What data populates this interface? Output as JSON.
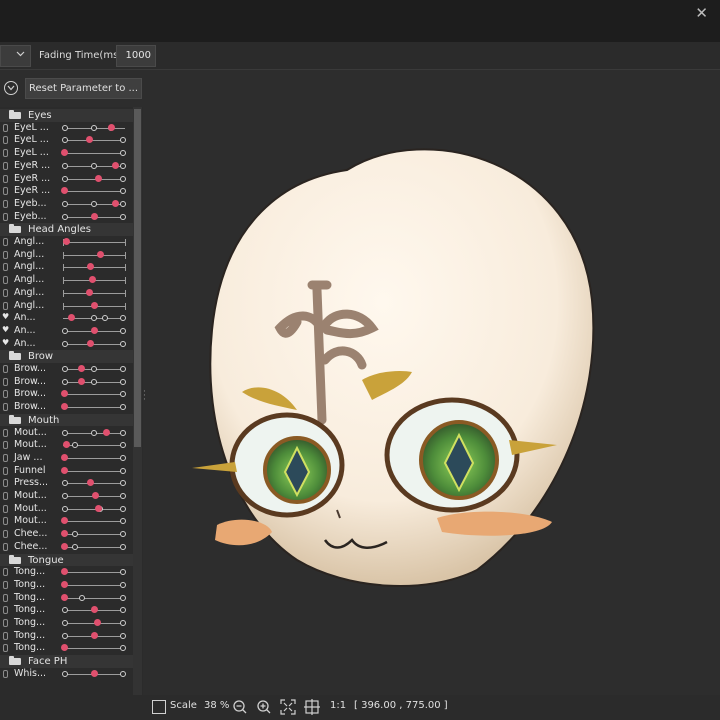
{
  "window": {
    "close_glyph": "✕"
  },
  "toolbar": {
    "dropdown_icon": "chevron-down-icon",
    "fading_label": "Fading Time(ms):",
    "fading_value": "1000"
  },
  "controls": {
    "reset_label": "Reset Parameter to ..."
  },
  "parameters": [
    {
      "type": "group",
      "label": "Eyes"
    },
    {
      "type": "param",
      "label": "EyeL ...",
      "keys": [
        0.03,
        0.5,
        0.78
      ],
      "value": 0.78
    },
    {
      "type": "param",
      "label": "EyeL ...",
      "keys": [
        0.03,
        0.97
      ],
      "value": 0.43
    },
    {
      "type": "param",
      "label": "EyeL ...",
      "keys": [
        0.97
      ],
      "value": 0.03
    },
    {
      "type": "param",
      "label": "EyeR ...",
      "keys": [
        0.03,
        0.5,
        0.97
      ],
      "value": 0.85
    },
    {
      "type": "param",
      "label": "EyeR ...",
      "keys": [
        0.03,
        0.97
      ],
      "value": 0.57
    },
    {
      "type": "param",
      "label": "EyeR ...",
      "keys": [
        0.97
      ],
      "value": 0.03
    },
    {
      "type": "param",
      "label": "Eyeb...",
      "keys": [
        0.03,
        0.5,
        0.97
      ],
      "value": 0.85
    },
    {
      "type": "param",
      "label": "Eyeb...",
      "keys": [
        0.03,
        0.97
      ],
      "value": 0.5
    },
    {
      "type": "group",
      "label": "Head Angles"
    },
    {
      "type": "param",
      "label": "Angl...",
      "keys": [],
      "ticks": true,
      "value": 0.05
    },
    {
      "type": "param",
      "label": "Angl...",
      "keys": [],
      "ticks": true,
      "value": 0.6
    },
    {
      "type": "param",
      "label": "Angl...",
      "keys": [],
      "ticks": true,
      "value": 0.45
    },
    {
      "type": "param",
      "label": "Angl...",
      "keys": [],
      "ticks": true,
      "value": 0.47
    },
    {
      "type": "param",
      "label": "Angl...",
      "keys": [],
      "ticks": true,
      "value": 0.42
    },
    {
      "type": "param",
      "label": "Angl...",
      "keys": [],
      "ticks": true,
      "value": 0.5
    },
    {
      "type": "param",
      "label": "An...",
      "heart": true,
      "keys": [
        0.5,
        0.68,
        0.97
      ],
      "value": 0.13
    },
    {
      "type": "param",
      "label": "An...",
      "heart": true,
      "keys": [
        0.03,
        0.97
      ],
      "value": 0.5
    },
    {
      "type": "param",
      "label": "An...",
      "heart": true,
      "keys": [
        0.03,
        0.97
      ],
      "value": 0.45
    },
    {
      "type": "group",
      "label": "Brow"
    },
    {
      "type": "param",
      "label": "Brow...",
      "keys": [
        0.03,
        0.5,
        0.97
      ],
      "value": 0.3
    },
    {
      "type": "param",
      "label": "Brow...",
      "keys": [
        0.03,
        0.5,
        0.97
      ],
      "value": 0.3
    },
    {
      "type": "param",
      "label": "Brow...",
      "keys": [
        0.97
      ],
      "value": 0.03
    },
    {
      "type": "param",
      "label": "Brow...",
      "keys": [
        0.97
      ],
      "value": 0.03
    },
    {
      "type": "group",
      "label": "Mouth"
    },
    {
      "type": "param",
      "label": "Mout...",
      "keys": [
        0.03,
        0.5,
        0.97
      ],
      "value": 0.7
    },
    {
      "type": "param",
      "label": "Mout...",
      "keys": [
        0.2,
        0.97
      ],
      "value": 0.05
    },
    {
      "type": "param",
      "label": "Jaw ...",
      "keys": [
        0.97
      ],
      "value": 0.03
    },
    {
      "type": "param",
      "label": "Funnel",
      "keys": [
        0.97
      ],
      "value": 0.03
    },
    {
      "type": "param",
      "label": "Press...",
      "keys": [
        0.03,
        0.97
      ],
      "value": 0.45
    },
    {
      "type": "param",
      "label": "Mout...",
      "keys": [
        0.03,
        0.97
      ],
      "value": 0.52
    },
    {
      "type": "param",
      "label": "Mout...",
      "keys": [
        0.03,
        0.6,
        0.97
      ],
      "value": 0.57
    },
    {
      "type": "param",
      "label": "Mout...",
      "keys": [
        0.97
      ],
      "value": 0.03
    },
    {
      "type": "param",
      "label": "Chee...",
      "keys": [
        0.2,
        0.97
      ],
      "value": 0.03
    },
    {
      "type": "param",
      "label": "Chee...",
      "keys": [
        0.2,
        0.97
      ],
      "value": 0.03
    },
    {
      "type": "group",
      "label": "Tongue"
    },
    {
      "type": "param",
      "label": "Tong...",
      "keys": [
        0.97
      ],
      "value": 0.03
    },
    {
      "type": "param",
      "label": "Tong...",
      "keys": [
        0.97
      ],
      "value": 0.03
    },
    {
      "type": "param",
      "label": "Tong...",
      "keys": [
        0.3,
        0.97
      ],
      "value": 0.03
    },
    {
      "type": "param",
      "label": "Tong...",
      "keys": [
        0.03,
        0.97
      ],
      "value": 0.5
    },
    {
      "type": "param",
      "label": "Tong...",
      "keys": [
        0.03,
        0.97
      ],
      "value": 0.55
    },
    {
      "type": "param",
      "label": "Tong...",
      "keys": [
        0.03,
        0.97
      ],
      "value": 0.5
    },
    {
      "type": "param",
      "label": "Tong...",
      "keys": [
        0.97
      ],
      "value": 0.03
    },
    {
      "type": "group",
      "label": "Face PH"
    },
    {
      "type": "param",
      "label": "Whis...",
      "keys": [
        0.03,
        0.97
      ],
      "value": 0.5
    }
  ],
  "status": {
    "scale_label": "Scale",
    "zoom_percent": "38 %",
    "zoom_out_icon": "zoom-out-icon",
    "zoom_in_icon": "zoom-in-icon",
    "fit_icon": "fit-screen-icon",
    "center_icon": "center-view-icon",
    "actual_size_label": "1:1",
    "coordinates": "[ 396.00 ,  775.00 ]"
  },
  "colors": {
    "accent": "#e0506e",
    "background": "#2d2d2d",
    "panel": "#2b2b2b"
  }
}
